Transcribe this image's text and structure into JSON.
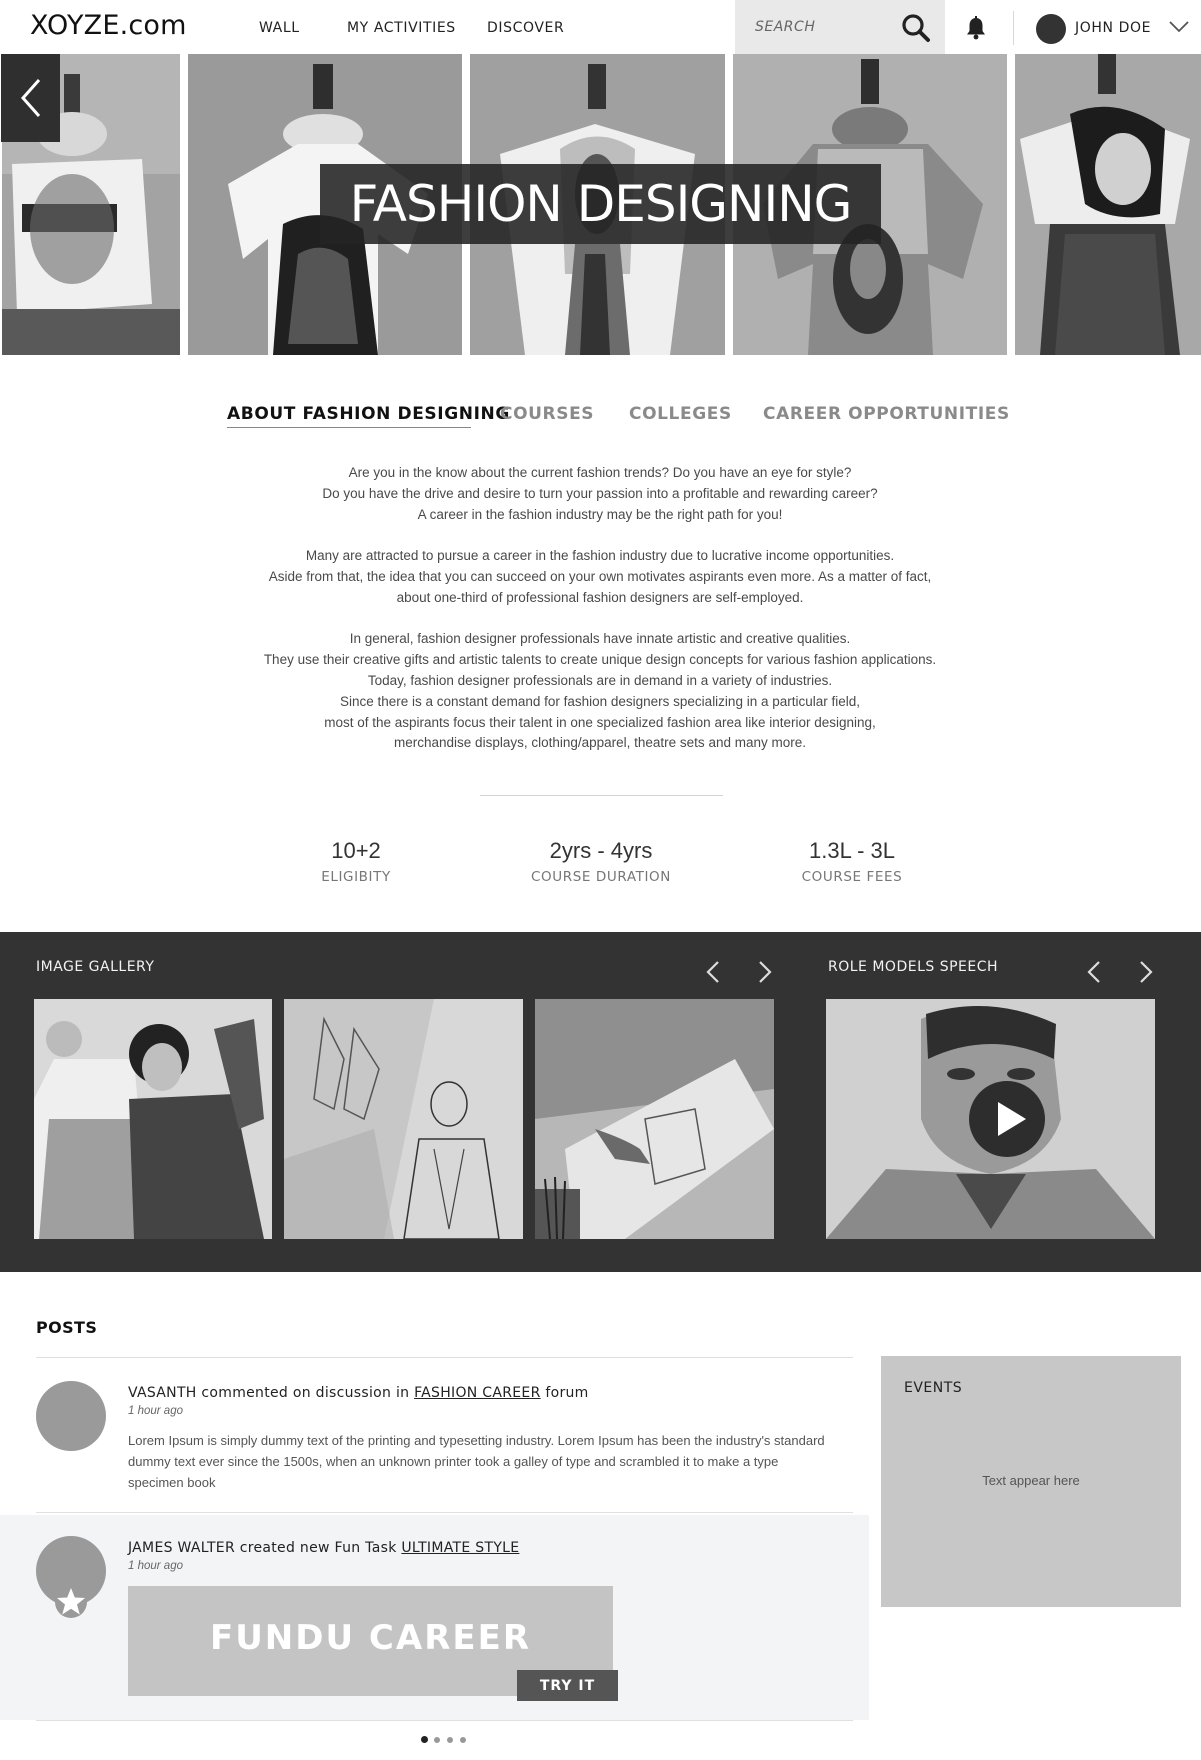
{
  "header": {
    "logo": "XOYZE.com",
    "nav": [
      {
        "label": "WALL"
      },
      {
        "label": "MY ACTIVITIES"
      },
      {
        "label": "DISCOVER"
      }
    ],
    "search": {
      "placeholder": "SEARCH",
      "value": ""
    },
    "user": {
      "name": "JOHN DOE"
    }
  },
  "hero": {
    "title": "FASHION DESIGNING"
  },
  "tabs": [
    {
      "label": "ABOUT FASHION DESIGNING",
      "active": true
    },
    {
      "label": "COURSES",
      "active": false
    },
    {
      "label": "COLLEGES",
      "active": false
    },
    {
      "label": "CAREER OPPORTUNITIES",
      "active": false
    }
  ],
  "about": {
    "paragraphs": [
      [
        "Are you in the know about the current fashion trends? Do you have an eye for style?",
        "Do you have the drive and desire to turn your passion into a profitable and rewarding career?",
        "A career in the fashion industry may be the right path for you!"
      ],
      [
        "Many are attracted to pursue a career in the fashion industry due to lucrative income opportunities.",
        "Aside from that, the idea that you can succeed on your own motivates aspirants even more. As a matter of fact,",
        "about one-third of professional fashion designers are self-employed."
      ],
      [
        "In general, fashion designer professionals have innate artistic and creative qualities.",
        "They use their creative gifts and artistic talents to create unique design concepts for various fashion applications.",
        "Today, fashion designer professionals are in demand in a variety of industries.",
        "Since there is a constant demand for fashion designers specializing in a particular field,",
        "most of the aspirants focus their talent in one specialized fashion area like interior designing,",
        "merchandise displays, clothing/apparel, theatre sets and many more."
      ]
    ]
  },
  "stats": [
    {
      "value": "10+2",
      "label": "ELIGIBITY"
    },
    {
      "value": "2yrs - 4yrs",
      "label": "COURSE DURATION"
    },
    {
      "value": "1.3L - 3L",
      "label": "COURSE FEES"
    }
  ],
  "gallery": {
    "title": "IMAGE GALLERY"
  },
  "role_models": {
    "title": "ROLE MODELS SPEECH"
  },
  "posts": {
    "title": "POSTS",
    "items": [
      {
        "author": "VASANTH",
        "action": " commented on discussion in ",
        "link": "FASHION CAREER",
        "suffix": " forum",
        "time": "1 hour ago",
        "body": "Lorem Ipsum is simply dummy text of the printing and typesetting industry. Lorem Ipsum has been the industry's standard dummy text ever since the 1500s, when an unknown printer took a galley of type and scrambled it to make a type specimen book"
      },
      {
        "author": "JAMES WALTER",
        "action": " created new Fun Task ",
        "link": "ULTIMATE STYLE",
        "suffix": "",
        "time": "1 hour ago",
        "banner_title": "FUNDU CAREER",
        "button_label": "TRY IT"
      }
    ]
  },
  "events": {
    "title": "EVENTS",
    "text": "Text appear here"
  },
  "pagination": {
    "pages": 4,
    "current": 1
  },
  "colors": {
    "dark_band": "#333333",
    "events_bg": "#c8c7c8",
    "banner_bg": "#c5c4c5"
  }
}
